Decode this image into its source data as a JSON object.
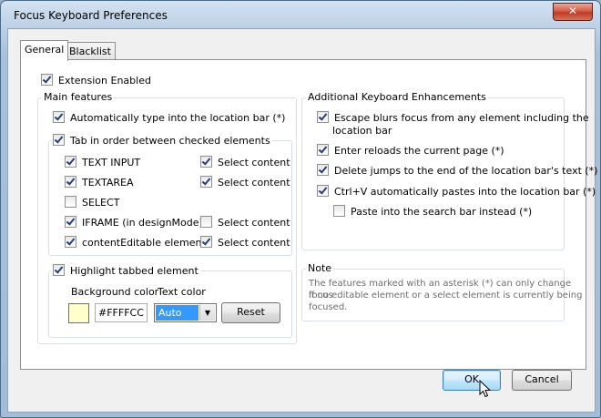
{
  "window": {
    "title": "Focus Keyboard Preferences",
    "close_glyph": "✕"
  },
  "tabs": [
    {
      "label": "General",
      "selected": true
    },
    {
      "label": "Blacklist",
      "selected": false
    }
  ],
  "general": {
    "extension_enabled": {
      "label": "Extension Enabled",
      "checked": true
    },
    "main_features": {
      "title": "Main features",
      "auto_type": {
        "label": "Automatically type into the location bar (*)",
        "checked": true
      },
      "tab_order": {
        "label": "Tab in order between checked elements",
        "checked": true,
        "elements": [
          {
            "label": "TEXT INPUT",
            "checked": true,
            "select_label": "Select content",
            "select_checked": true
          },
          {
            "label": "TEXTAREA",
            "checked": true,
            "select_label": "Select content",
            "select_checked": true
          },
          {
            "label": "SELECT",
            "checked": false
          },
          {
            "label": "IFRAME (in designMode)",
            "checked": true,
            "select_label": "Select content",
            "select_checked": false
          },
          {
            "label": "contentEditable elements",
            "checked": true,
            "select_label": "Select content",
            "select_checked": true
          }
        ]
      },
      "highlight": {
        "label": "Highlight tabbed element",
        "checked": true,
        "bg_color_label": "Background color",
        "text_color_label": "Text color",
        "bg_color_value": "#FFFFCC",
        "text_color_value": "Auto",
        "reset_label": "Reset"
      }
    },
    "additional": {
      "title": "Additional Keyboard Enhancements",
      "items": [
        {
          "label": "Escape blurs focus from any element including the",
          "label2": "location bar",
          "checked": true
        },
        {
          "label": "Enter reloads the current page (*)",
          "checked": true
        },
        {
          "label": "Delete jumps to the end of the location bar's text (*)",
          "checked": true
        },
        {
          "label": "Ctrl+V automatically pastes into the location bar (*)",
          "checked": true
        },
        {
          "label": "Paste into the search bar instead (*)",
          "checked": false
        }
      ]
    },
    "note": {
      "title": "Note",
      "line1": "The features marked with an asterisk (*) can only change focus",
      "line2": "if no editable element or a select element is currently being",
      "line3": "focused."
    }
  },
  "footer": {
    "ok_label": "OK",
    "cancel_label": "Cancel"
  }
}
